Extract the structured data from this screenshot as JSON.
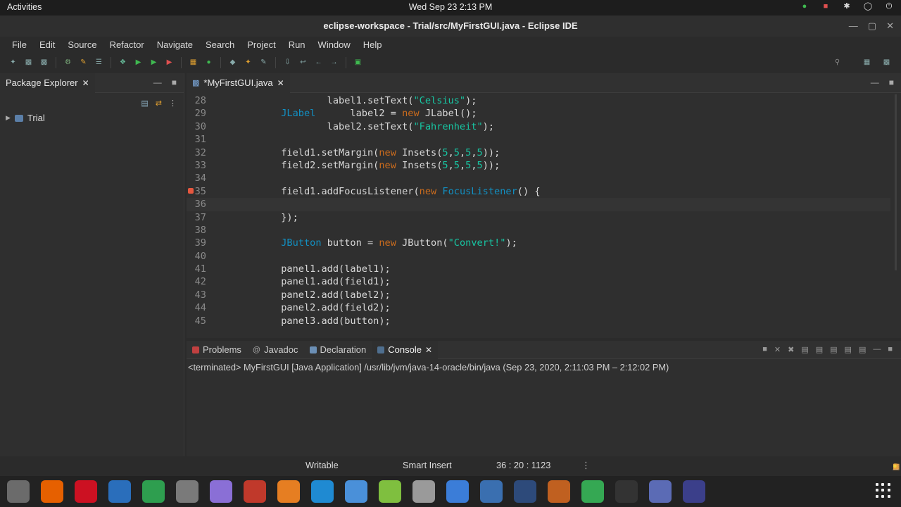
{
  "system": {
    "activities_label": "Activities",
    "clock": "Wed Sep 23  2:13 PM"
  },
  "window": {
    "title": "eclipse-workspace - Trial/src/MyFirstGUI.java - Eclipse IDE"
  },
  "menu": {
    "items": [
      "File",
      "Edit",
      "Source",
      "Refactor",
      "Navigate",
      "Search",
      "Project",
      "Run",
      "Window",
      "Help"
    ]
  },
  "package_explorer": {
    "tab_label": "Package Explorer",
    "tree_item": "Trial"
  },
  "editor": {
    "tab_label": "*MyFirstGUI.java",
    "lines": [
      {
        "num": "28",
        "segments": [
          {
            "t": "                    label1.setText(",
            "c": "txt"
          },
          {
            "t": "\"Celsius\"",
            "c": "str"
          },
          {
            "t": ");",
            "c": "txt"
          }
        ]
      },
      {
        "num": "29",
        "segments": [
          {
            "t": "            ",
            "c": "txt"
          },
          {
            "t": "JLabel",
            "c": "cls"
          },
          {
            "t": "      label2 = ",
            "c": "txt"
          },
          {
            "t": "new",
            "c": "kw"
          },
          {
            "t": " JLabel();",
            "c": "txt"
          }
        ]
      },
      {
        "num": "30",
        "segments": [
          {
            "t": "                    label2.setText(",
            "c": "txt"
          },
          {
            "t": "\"Fahrenheit\"",
            "c": "str"
          },
          {
            "t": ");",
            "c": "txt"
          }
        ]
      },
      {
        "num": "31",
        "segments": []
      },
      {
        "num": "32",
        "segments": [
          {
            "t": "            field1.setMargin(",
            "c": "txt"
          },
          {
            "t": "new",
            "c": "kw"
          },
          {
            "t": " Insets(",
            "c": "txt"
          },
          {
            "t": "5",
            "c": "str"
          },
          {
            "t": ",",
            "c": "txt"
          },
          {
            "t": "5",
            "c": "str"
          },
          {
            "t": ",",
            "c": "txt"
          },
          {
            "t": "5",
            "c": "str"
          },
          {
            "t": ",",
            "c": "txt"
          },
          {
            "t": "5",
            "c": "str"
          },
          {
            "t": "));",
            "c": "txt"
          }
        ]
      },
      {
        "num": "33",
        "segments": [
          {
            "t": "            field2.setMargin(",
            "c": "txt"
          },
          {
            "t": "new",
            "c": "kw"
          },
          {
            "t": " Insets(",
            "c": "txt"
          },
          {
            "t": "5",
            "c": "str"
          },
          {
            "t": ",",
            "c": "txt"
          },
          {
            "t": "5",
            "c": "str"
          },
          {
            "t": ",",
            "c": "txt"
          },
          {
            "t": "5",
            "c": "str"
          },
          {
            "t": ",",
            "c": "txt"
          },
          {
            "t": "5",
            "c": "str"
          },
          {
            "t": "));",
            "c": "txt"
          }
        ]
      },
      {
        "num": "34",
        "segments": []
      },
      {
        "num": "35",
        "warn": true,
        "segments": [
          {
            "t": "            field1.addFocusListener(",
            "c": "txt"
          },
          {
            "t": "new",
            "c": "kw"
          },
          {
            "t": " ",
            "c": "txt"
          },
          {
            "t": "FocusListener",
            "c": "cls"
          },
          {
            "t": "() {",
            "c": "txt"
          }
        ]
      },
      {
        "num": "36",
        "current": true,
        "segments": []
      },
      {
        "num": "37",
        "segments": [
          {
            "t": "            });",
            "c": "txt"
          }
        ]
      },
      {
        "num": "38",
        "segments": []
      },
      {
        "num": "39",
        "segments": [
          {
            "t": "            ",
            "c": "txt"
          },
          {
            "t": "JButton",
            "c": "cls"
          },
          {
            "t": " button = ",
            "c": "txt"
          },
          {
            "t": "new",
            "c": "kw"
          },
          {
            "t": " JButton(",
            "c": "txt"
          },
          {
            "t": "\"Convert!\"",
            "c": "str"
          },
          {
            "t": ");",
            "c": "txt"
          }
        ]
      },
      {
        "num": "40",
        "segments": []
      },
      {
        "num": "41",
        "segments": [
          {
            "t": "            panel1.add(label1);",
            "c": "txt"
          }
        ]
      },
      {
        "num": "42",
        "segments": [
          {
            "t": "            panel1.add(field1);",
            "c": "txt"
          }
        ]
      },
      {
        "num": "43",
        "segments": [
          {
            "t": "            panel2.add(label2);",
            "c": "txt"
          }
        ]
      },
      {
        "num": "44",
        "segments": [
          {
            "t": "            panel2.add(field2);",
            "c": "txt"
          }
        ]
      },
      {
        "num": "45",
        "segments": [
          {
            "t": "            panel3.add(button);",
            "c": "txt"
          }
        ]
      }
    ]
  },
  "bottom_tabs": {
    "problems": "Problems",
    "javadoc": "Javadoc",
    "declaration": "Declaration",
    "console": "Console"
  },
  "console": {
    "terminated_line": "<terminated> MyFirstGUI [Java Application] /usr/lib/jvm/java-14-oracle/bin/java  (Sep 23, 2020, 2:11:03 PM – 2:12:02 PM)"
  },
  "status": {
    "writable": "Writable",
    "insert_mode": "Smart Insert",
    "position": "36 : 20 : 1123"
  },
  "colors": {
    "keyword": "#cc6c1d",
    "class": "#1290c3",
    "string": "#17c6a3"
  },
  "dock_icons": [
    "files-icon",
    "firefox-icon",
    "opera-icon",
    "document-icon",
    "spreadsheet-icon",
    "drive-icon",
    "screenshot-icon",
    "terminal-icon",
    "sublime-icon",
    "vscode-icon",
    "browser-icon",
    "image-viewer-icon",
    "settings-icon",
    "display-icon",
    "editor-icon",
    "tex-icon",
    "media-icon",
    "chrome-icon",
    "obs-icon",
    "virtualbox-icon",
    "eclipse-icon"
  ]
}
